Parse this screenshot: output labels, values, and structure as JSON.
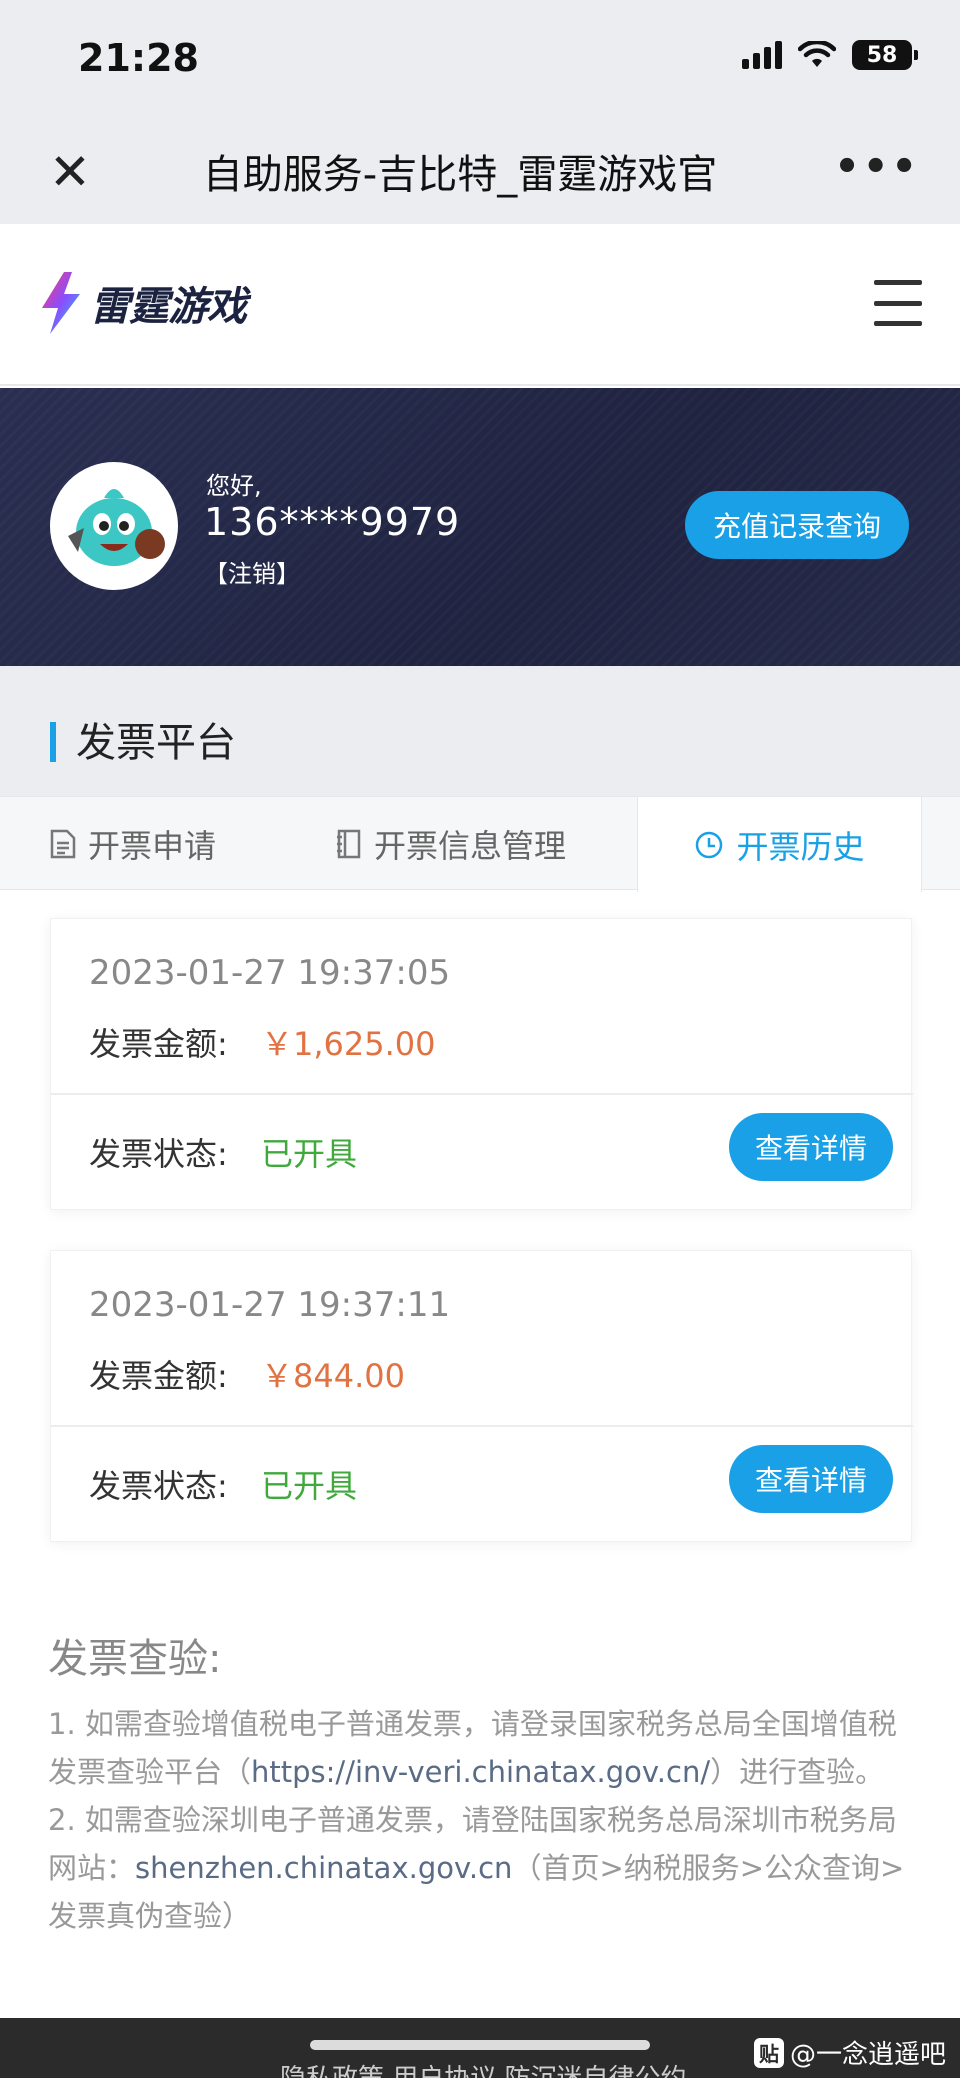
{
  "status_bar": {
    "time": "21:28",
    "battery": "58"
  },
  "nav": {
    "close_icon": "close-icon",
    "title": "自助服务-吉比特_雷霆游戏官",
    "more_icon": "more-icon"
  },
  "site": {
    "logo_text": "雷霆游戏",
    "menu_icon": "hamburger-icon"
  },
  "user": {
    "greeting": "您好,",
    "phone": "136****9979",
    "logout": "【注销】",
    "recharge_button": "充值记录查询"
  },
  "section": {
    "title": "发票平台"
  },
  "tabs": [
    {
      "label": "开票申请",
      "icon": "document-icon",
      "active": false
    },
    {
      "label": "开票信息管理",
      "icon": "notebook-icon",
      "active": false
    },
    {
      "label": "开票历史",
      "icon": "clock-icon",
      "active": true
    }
  ],
  "invoices": [
    {
      "date": "2023-01-27 19:37:05",
      "amount_label": "发票金额:",
      "amount": "￥1,625.00",
      "status_label": "发票状态:",
      "status": "已开具",
      "detail_button": "查看详情"
    },
    {
      "date": "2023-01-27 19:37:11",
      "amount_label": "发票金额:",
      "amount": "￥844.00",
      "status_label": "发票状态:",
      "status": "已开具",
      "detail_button": "查看详情"
    }
  ],
  "verify": {
    "title": "发票查验:",
    "line1_a": "1. 如需查验增值税电子普通发票，请登录国家税务总局全国增值税发票查验平台（",
    "line1_link": "https://inv-veri.chinatax.gov.cn/",
    "line1_b": "）进行查验。",
    "line2_a": "2. 如需查验深圳电子普通发票，请登陆国家税务总局深圳市税务局网站：",
    "line2_link": "shenzhen.chinatax.gov.cn",
    "line2_b": "（首页>纳税服务>公众查询>发票真伪查验）"
  },
  "footer": {
    "text": "隐私政策  用户协议  防沉迷自律公约",
    "watermark": "@一念逍遥吧",
    "watermark_icon": "贴"
  },
  "colors": {
    "accent": "#1aa0e6",
    "amount": "#e07341",
    "status_ok": "#3fa93c",
    "banner": "#1f2340"
  }
}
